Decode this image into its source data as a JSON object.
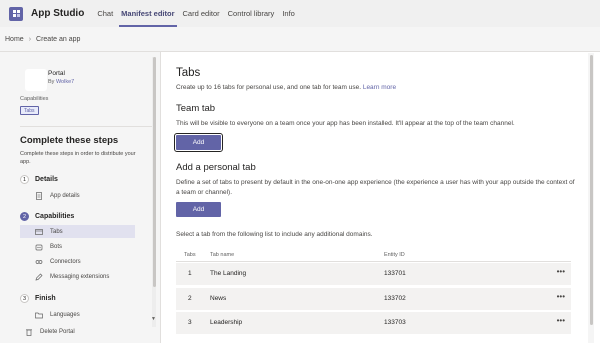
{
  "topbar": {
    "title": "App Studio",
    "tabs": [
      {
        "label": "Chat"
      },
      {
        "label": "Manifest editor",
        "active": true
      },
      {
        "label": "Card editor"
      },
      {
        "label": "Control library"
      },
      {
        "label": "Info"
      }
    ]
  },
  "breadcrumb": {
    "home": "Home",
    "current": "Create an app"
  },
  "sidebar": {
    "app_name": "Portal",
    "app_by_prefix": "By",
    "app_by_name": "Wolke7",
    "capabilities_label": "Capabilities",
    "capability_pill": "Tabs",
    "steps_title": "Complete these steps",
    "steps_desc": "Complete these steps in order to distribute your app.",
    "steps": [
      {
        "num": "1",
        "label": "Details"
      },
      {
        "num": "2",
        "label": "Capabilities"
      },
      {
        "num": "3",
        "label": "Finish"
      }
    ],
    "items": {
      "app_details": "App details",
      "tabs": "Tabs",
      "bots": "Bots",
      "connectors": "Connectors",
      "messaging": "Messaging extensions",
      "languages": "Languages",
      "delete": "Delete Portal"
    }
  },
  "main": {
    "title": "Tabs",
    "subtitle": "Create up to 16 tabs for personal use, and one tab for team use.",
    "learn_more": "Learn more",
    "team_tab": {
      "title": "Team tab",
      "desc": "This will be visible to everyone on a team once your app has been installed. It'll appear at the top of the team channel.",
      "button": "Add"
    },
    "personal_tab": {
      "title": "Add a personal tab",
      "desc": "Define a set of tabs to present by default in the one-on-one app experience (the experience a user has with your app outside the context of a team or channel).",
      "button": "Add"
    },
    "select_text": "Select a tab from the following list to include any additional domains.",
    "table": {
      "headers": [
        "Tabs",
        "Tab name",
        "Entity ID"
      ],
      "rows": [
        {
          "num": "1",
          "name": "The Landing",
          "entity": "133701",
          "more": "•••"
        },
        {
          "num": "2",
          "name": "News",
          "entity": "133702",
          "more": "•••"
        },
        {
          "num": "3",
          "name": "Leadership",
          "entity": "133703",
          "more": "•••"
        }
      ]
    }
  }
}
